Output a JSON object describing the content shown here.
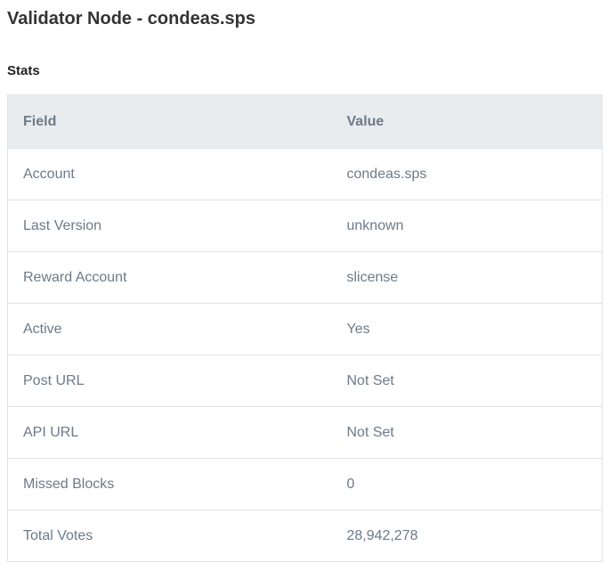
{
  "header": {
    "title": "Validator Node - condeas.sps"
  },
  "stats": {
    "section_title": "Stats",
    "columns": [
      "Field",
      "Value"
    ],
    "rows": [
      {
        "field": "Account",
        "value": "condeas.sps"
      },
      {
        "field": "Last Version",
        "value": "unknown"
      },
      {
        "field": "Reward Account",
        "value": "slicense"
      },
      {
        "field": "Active",
        "value": "Yes"
      },
      {
        "field": "Post URL",
        "value": "Not Set"
      },
      {
        "field": "API URL",
        "value": "Not Set"
      },
      {
        "field": "Missed Blocks",
        "value": "0"
      },
      {
        "field": "Total Votes",
        "value": "28,942,278"
      }
    ]
  }
}
